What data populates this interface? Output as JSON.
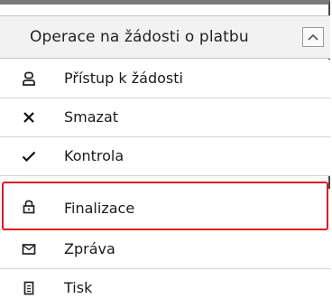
{
  "panel": {
    "title": "Operace na žádosti o platbu",
    "collapse_icon": "chevron-up-icon"
  },
  "items": [
    {
      "label": "Přístup k žádosti",
      "icon": "user-icon"
    },
    {
      "label": "Smazat",
      "icon": "close-icon"
    },
    {
      "label": "Kontrola",
      "icon": "checkmark-icon"
    },
    {
      "label": "Finalizace",
      "icon": "lock-icon",
      "highlighted": true
    },
    {
      "label": "Zpráva",
      "icon": "envelope-icon"
    },
    {
      "label": "Tisk",
      "icon": "document-icon"
    }
  ],
  "colors": {
    "highlight": "#e2181f",
    "header_bg": "#f2f2f2"
  }
}
